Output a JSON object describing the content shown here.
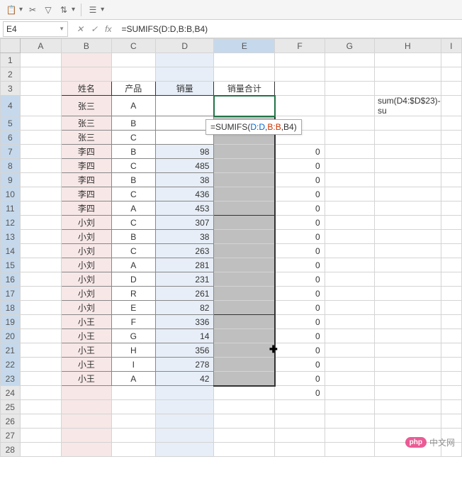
{
  "name_box": "E4",
  "formula": "=SUMIFS(D:D,B:B,B4)",
  "tooltip_prefix": "=SUMIFS(",
  "tooltip_ref1": "D:D",
  "tooltip_ref2": "B:B",
  "tooltip_arg3": "B4",
  "columns": [
    "A",
    "B",
    "C",
    "D",
    "E",
    "F",
    "G",
    "H",
    "I"
  ],
  "headers": {
    "b": "姓名",
    "c": "产品",
    "d": "销量",
    "e": "销量合计"
  },
  "h4": "sum(D4:$D$23)-su",
  "f24": "0",
  "rows": [
    {
      "r": 4,
      "b": "张三",
      "c": "A",
      "d": "",
      "f": ""
    },
    {
      "r": 5,
      "b": "张三",
      "c": "B",
      "d": "",
      "f": ""
    },
    {
      "r": 6,
      "b": "张三",
      "c": "C",
      "d": "",
      "f": ""
    },
    {
      "r": 7,
      "b": "李四",
      "c": "B",
      "d": "98",
      "f": "0"
    },
    {
      "r": 8,
      "b": "李四",
      "c": "C",
      "d": "485",
      "f": "0"
    },
    {
      "r": 9,
      "b": "李四",
      "c": "B",
      "d": "38",
      "f": "0"
    },
    {
      "r": 10,
      "b": "李四",
      "c": "C",
      "d": "436",
      "f": "0"
    },
    {
      "r": 11,
      "b": "李四",
      "c": "A",
      "d": "453",
      "f": "0"
    },
    {
      "r": 12,
      "b": "小刘",
      "c": "C",
      "d": "307",
      "f": "0"
    },
    {
      "r": 13,
      "b": "小刘",
      "c": "B",
      "d": "38",
      "f": "0"
    },
    {
      "r": 14,
      "b": "小刘",
      "c": "C",
      "d": "263",
      "f": "0"
    },
    {
      "r": 15,
      "b": "小刘",
      "c": "A",
      "d": "281",
      "f": "0"
    },
    {
      "r": 16,
      "b": "小刘",
      "c": "D",
      "d": "231",
      "f": "0"
    },
    {
      "r": 17,
      "b": "小刘",
      "c": "R",
      "d": "261",
      "f": "0"
    },
    {
      "r": 18,
      "b": "小刘",
      "c": "E",
      "d": "82",
      "f": "0"
    },
    {
      "r": 19,
      "b": "小王",
      "c": "F",
      "d": "336",
      "f": "0"
    },
    {
      "r": 20,
      "b": "小王",
      "c": "G",
      "d": "14",
      "f": "0"
    },
    {
      "r": 21,
      "b": "小王",
      "c": "H",
      "d": "356",
      "f": "0"
    },
    {
      "r": 22,
      "b": "小王",
      "c": "I",
      "d": "278",
      "f": "0"
    },
    {
      "r": 23,
      "b": "小王",
      "c": "A",
      "d": "42",
      "f": "0"
    }
  ],
  "watermark": {
    "badge": "php",
    "text": "中文网"
  }
}
